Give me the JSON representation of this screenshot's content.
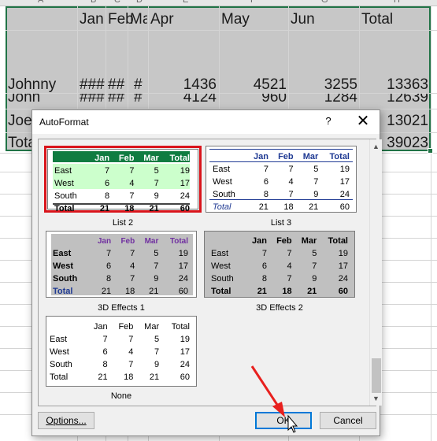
{
  "sheet": {
    "column_headers": [
      "A",
      "B",
      "C",
      "D",
      "E",
      "F",
      "G",
      "H"
    ],
    "header_row": [
      "Jan",
      "Feb",
      "Ma",
      "Apr",
      "May",
      "Jun",
      "Total"
    ],
    "rows": [
      {
        "name": "Johnny",
        "c1": "###",
        "c2": "##",
        "c3": "#",
        "apr": "1436",
        "may": "4521",
        "jun": "3255",
        "total": "13363"
      },
      {
        "name": "John",
        "c1": "###",
        "c2": "##",
        "c3": "#",
        "apr": "4124",
        "may": "960",
        "jun": "1284",
        "total": "12639"
      },
      {
        "name": "Joe",
        "total": "13021"
      },
      {
        "name": "Tota",
        "total": "39023"
      }
    ]
  },
  "dialog": {
    "title": "AutoFormat",
    "help_label": "?",
    "close_label": "✕",
    "options_label": "Options...",
    "ok_label": "OK",
    "cancel_label": "Cancel",
    "formats": [
      {
        "caption": "List 2",
        "selected": true,
        "header": [
          "",
          "Jan",
          "Feb",
          "Mar",
          "Total"
        ],
        "rows": [
          [
            "East",
            "7",
            "7",
            "5",
            "19"
          ],
          [
            "West",
            "6",
            "4",
            "7",
            "17"
          ],
          [
            "South",
            "8",
            "7",
            "9",
            "24"
          ],
          [
            "Total",
            "21",
            "18",
            "21",
            "60"
          ]
        ]
      },
      {
        "caption": "List 3",
        "selected": false,
        "header": [
          "",
          "Jan",
          "Feb",
          "Mar",
          "Total"
        ],
        "rows": [
          [
            "East",
            "7",
            "7",
            "5",
            "19"
          ],
          [
            "West",
            "6",
            "4",
            "7",
            "17"
          ],
          [
            "South",
            "8",
            "7",
            "9",
            "24"
          ],
          [
            "Total",
            "21",
            "18",
            "21",
            "60"
          ]
        ]
      },
      {
        "caption": "3D Effects 1",
        "selected": false,
        "header": [
          "",
          "Jan",
          "Feb",
          "Mar",
          "Total"
        ],
        "rows": [
          [
            "East",
            "7",
            "7",
            "5",
            "19"
          ],
          [
            "West",
            "6",
            "4",
            "7",
            "17"
          ],
          [
            "South",
            "8",
            "7",
            "9",
            "24"
          ],
          [
            "Total",
            "21",
            "18",
            "21",
            "60"
          ]
        ]
      },
      {
        "caption": "3D Effects 2",
        "selected": false,
        "header": [
          "",
          "Jan",
          "Feb",
          "Mar",
          "Total"
        ],
        "rows": [
          [
            "East",
            "7",
            "7",
            "5",
            "19"
          ],
          [
            "West",
            "6",
            "4",
            "7",
            "17"
          ],
          [
            "South",
            "8",
            "7",
            "9",
            "24"
          ],
          [
            "Total",
            "21",
            "18",
            "21",
            "60"
          ]
        ]
      },
      {
        "caption": "None",
        "selected": false,
        "header": [
          "",
          "Jan",
          "Feb",
          "Mar",
          "Total"
        ],
        "rows": [
          [
            "East",
            "7",
            "7",
            "5",
            "19"
          ],
          [
            "West",
            "6",
            "4",
            "7",
            "17"
          ],
          [
            "South",
            "8",
            "7",
            "9",
            "24"
          ],
          [
            "Total",
            "21",
            "18",
            "21",
            "60"
          ]
        ]
      }
    ]
  },
  "colors": {
    "selection_fill": "#c7c7c7",
    "selection_border": "#217346",
    "highlight_frame": "#d9141b",
    "list2_header": "#107c41",
    "list2_row": "#ccffcc",
    "list3_header_text": "#1f3a93",
    "effects_header_text": "#7030a0",
    "annotation_arrow": "#e8201e"
  }
}
